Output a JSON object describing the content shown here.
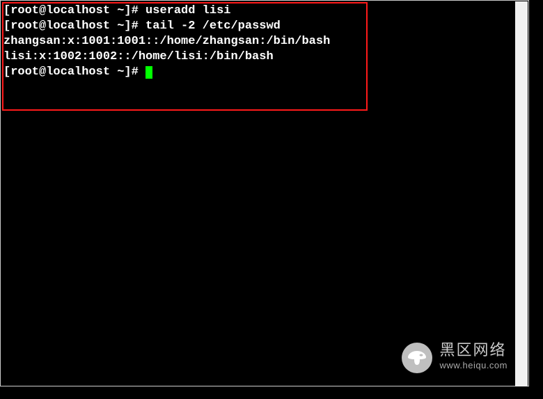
{
  "terminal": {
    "lines": [
      {
        "prompt": "[root@localhost ~]# ",
        "cmd": "useradd lisi",
        "out": ""
      },
      {
        "prompt": "[root@localhost ~]# ",
        "cmd": "tail -2 /etc/passwd",
        "out": ""
      },
      {
        "prompt": "",
        "cmd": "",
        "out": "zhangsan:x:1001:1001::/home/zhangsan:/bin/bash"
      },
      {
        "prompt": "",
        "cmd": "",
        "out": "lisi:x:1002:1002::/home/lisi:/bin/bash"
      },
      {
        "prompt": "[root@localhost ~]# ",
        "cmd": "",
        "out": "",
        "cursor": true
      }
    ],
    "highlight_color": "#ff1a1a"
  },
  "watermark": {
    "title": "黑区网络",
    "url": "www.heiqu.com"
  }
}
